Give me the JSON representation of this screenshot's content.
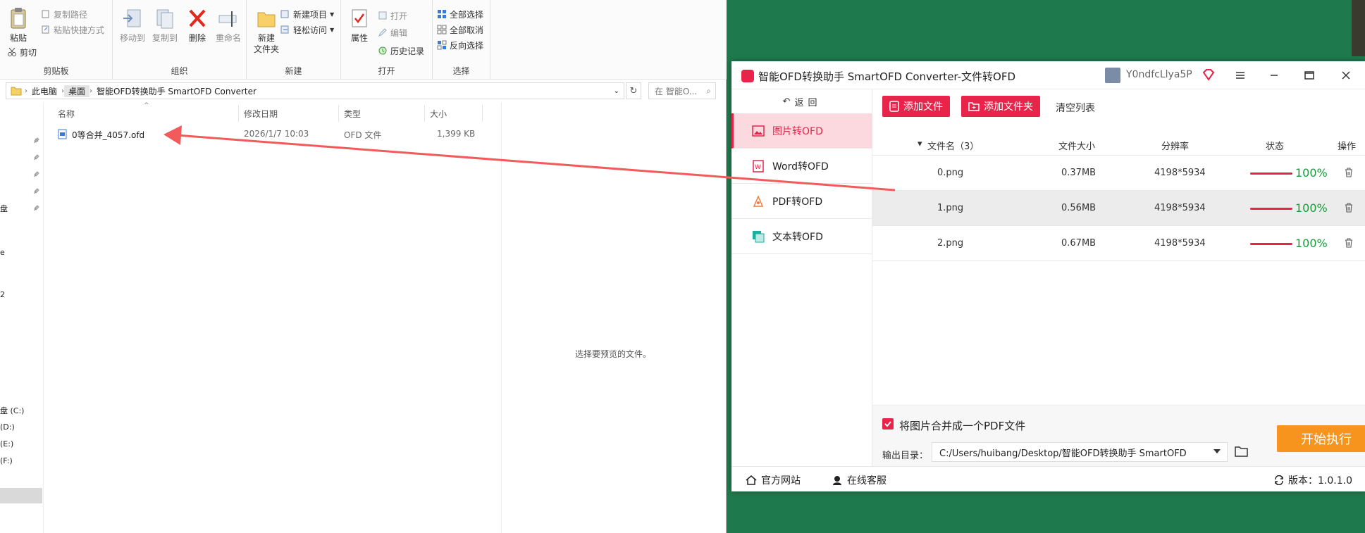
{
  "explorer": {
    "ribbon": {
      "clipboard": {
        "paste": "粘贴",
        "copy_path": "复制路径",
        "paste_shortcut": "粘贴快捷方式",
        "cut": "剪切",
        "group": "剪贴板"
      },
      "organize": {
        "move_to": "移动到",
        "copy_to": "复制到",
        "delete": "删除",
        "rename": "重命名",
        "group": "组织"
      },
      "new": {
        "new_folder_line1": "新建",
        "new_folder_line2": "文件夹",
        "new_item": "新建项目",
        "easy_access": "轻松访问",
        "group": "新建"
      },
      "open": {
        "properties": "属性",
        "open": "打开",
        "edit": "编辑",
        "history": "历史记录",
        "group": "打开"
      },
      "select": {
        "select_all": "全部选择",
        "select_none": "全部取消",
        "invert": "反向选择",
        "group": "选择"
      }
    },
    "address": {
      "crumbs": [
        "此电脑",
        "桌面",
        "智能OFD转换助手 SmartOFD Converter"
      ],
      "search_placeholder": "在 智能O..."
    },
    "nav_fragments": [
      "盘",
      "e",
      "2",
      "盘 (C:)",
      "(D:)",
      "(E:)",
      "(F:)"
    ],
    "columns": {
      "name": "名称",
      "modified": "修改日期",
      "type": "类型",
      "size": "大小"
    },
    "file": {
      "name": "0等合并_4057.ofd",
      "modified": "2026/1/7 10:03",
      "type": "OFD 文件",
      "size": "1,399 KB"
    },
    "preview_text": "选择要预览的文件。"
  },
  "app": {
    "title": "智能OFD转换助手 SmartOFD Converter-文件转OFD",
    "user": "Y0ndfcLlya5P",
    "back_label": "返回",
    "sidebar": [
      {
        "label": "图片转OFD",
        "active": true
      },
      {
        "label": "Word转OFD",
        "active": false
      },
      {
        "label": "PDF转OFD",
        "active": false
      },
      {
        "label": "文本转OFD",
        "active": false
      }
    ],
    "toolbar": {
      "add_file": "添加文件",
      "add_folder": "添加文件夹",
      "clear_list": "清空列表"
    },
    "table": {
      "headers": {
        "name": "文件名（3）",
        "size": "文件大小",
        "resolution": "分辨率",
        "status": "状态",
        "action": "操作"
      },
      "rows": [
        {
          "name": "0.png",
          "size": "0.37MB",
          "resolution": "4198*5934",
          "progress": 100,
          "pct": "100%"
        },
        {
          "name": "1.png",
          "size": "0.56MB",
          "resolution": "4198*5934",
          "progress": 100,
          "pct": "100%"
        },
        {
          "name": "2.png",
          "size": "0.67MB",
          "resolution": "4198*5934",
          "progress": 100,
          "pct": "100%"
        }
      ]
    },
    "merge_label": "将图片合并成一个PDF文件",
    "output_label": "输出目录：",
    "output_path": "C:/Users/huibang/Desktop/智能OFD转换助手 SmartOFD",
    "start_label": "开始执行",
    "footer": {
      "website": "官方网站",
      "support": "在线客服",
      "version": "版本：1.0.1.0"
    },
    "colors": {
      "accent": "#e8244a",
      "orange": "#f7941d",
      "success": "#1a9b3c"
    }
  }
}
